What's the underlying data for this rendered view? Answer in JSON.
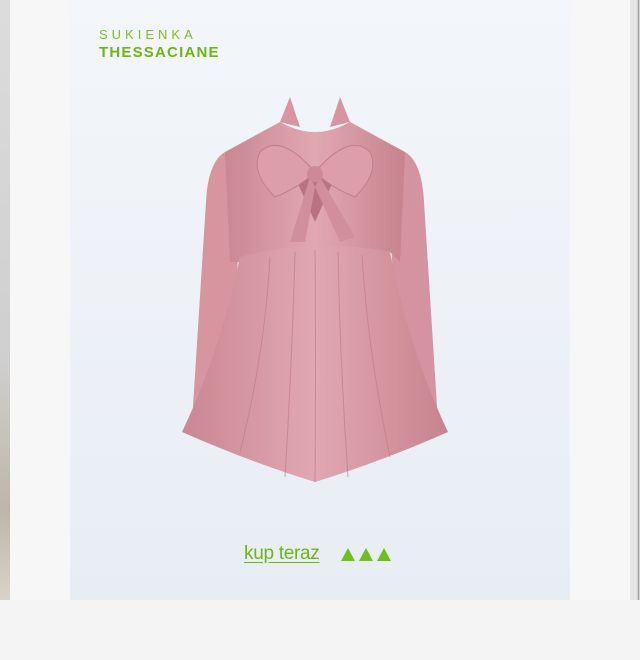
{
  "product": {
    "category": "SUKIENKA",
    "name": "THESSACIANE"
  },
  "cta": {
    "label": "kup teraz",
    "arrow_icons": [
      "triangle-up-icon",
      "triangle-up-icon",
      "triangle-up-icon"
    ]
  },
  "colors": {
    "accent_green": "#6cb80f",
    "dress_pink": "#d89aa5",
    "card_background": "#eef2f7"
  }
}
